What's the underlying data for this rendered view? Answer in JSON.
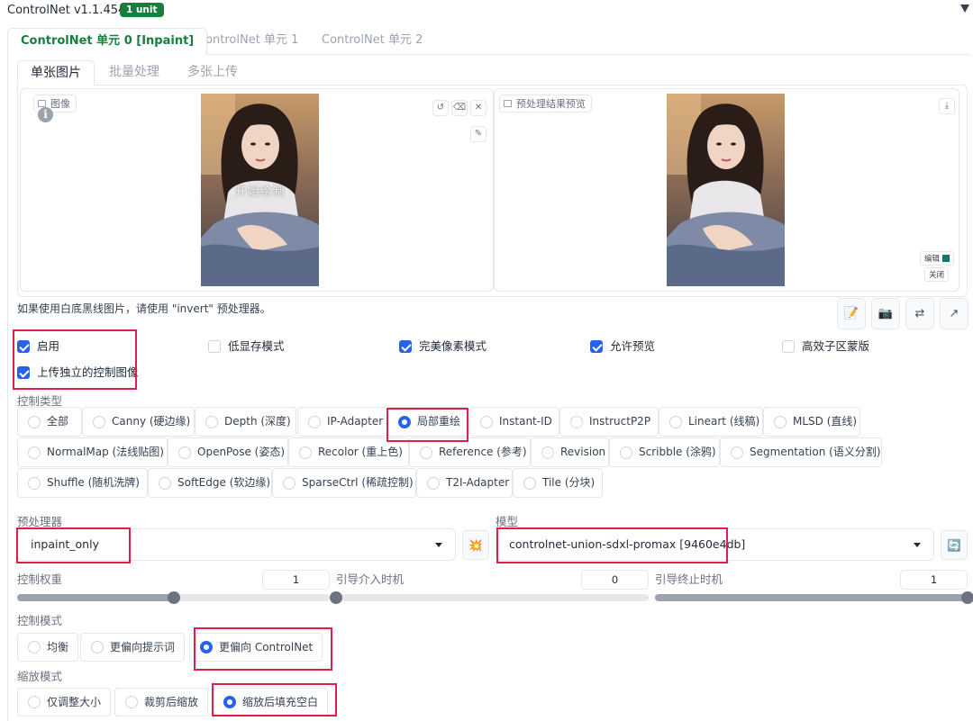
{
  "header": {
    "title": "ControlNet v1.1.454",
    "badge": "1 unit"
  },
  "outer_tabs": [
    {
      "label": "ControlNet 单元 0 [Inpaint]",
      "active": true
    },
    {
      "label": "ControlNet 单元 1",
      "active": false
    },
    {
      "label": "ControlNet 单元 2",
      "active": false
    }
  ],
  "inner_tabs": [
    {
      "label": "单张图片",
      "active": true
    },
    {
      "label": "批量处理",
      "active": false
    },
    {
      "label": "多张上传",
      "active": false
    }
  ],
  "image_input": {
    "label": "图像",
    "overlay_text": "开始绘制",
    "buttons": {
      "undo": "↺",
      "clear": "⌫",
      "close": "✕",
      "brush": "✎"
    }
  },
  "preview": {
    "label": "预处理结果预览",
    "download": "⤓",
    "edit_label": "编辑",
    "close_label": "关闭"
  },
  "tip": "如果使用白底黑线图片，请使用 \"invert\" 预处理器。",
  "tool_buttons": [
    "📝",
    "📷",
    "⇄",
    "↗"
  ],
  "checkboxes": [
    {
      "label": "启用",
      "checked": true
    },
    {
      "label": "低显存模式",
      "checked": false
    },
    {
      "label": "完美像素模式",
      "checked": true
    },
    {
      "label": "允许预览",
      "checked": true
    },
    {
      "label": "高效子区蒙版",
      "checked": false
    },
    {
      "label": "上传独立的控制图像",
      "checked": true
    }
  ],
  "control_type": {
    "label": "控制类型",
    "options": [
      "全部",
      "Canny (硬边缘)",
      "Depth (深度)",
      "IP-Adapter",
      "局部重绘",
      "Instant-ID",
      "InstructP2P",
      "Lineart (线稿)",
      "MLSD (直线)",
      "NormalMap (法线贴图)",
      "OpenPose (姿态)",
      "Recolor (重上色)",
      "Reference (参考)",
      "Revision",
      "Scribble (涂鸦)",
      "Segmentation (语义分割)",
      "Shuffle (随机洗牌)",
      "SoftEdge (软边缘)",
      "SparseCtrl (稀疏控制)",
      "T2I-Adapter",
      "Tile (分块)"
    ],
    "selected": "局部重绘"
  },
  "preprocessor": {
    "label": "预处理器",
    "value": "inpaint_only",
    "run_icon": "💥"
  },
  "model": {
    "label": "模型",
    "value": "controlnet-union-sdxl-promax [9460e4db]",
    "refresh_icon": "🔄"
  },
  "sliders": {
    "weight": {
      "label": "控制权重",
      "value": "1",
      "fraction": 0.5
    },
    "start": {
      "label": "引导介入时机",
      "value": "0",
      "fraction": 0.0
    },
    "end": {
      "label": "引导终止时机",
      "value": "1",
      "fraction": 1.0
    }
  },
  "control_mode": {
    "label": "控制模式",
    "options": [
      "均衡",
      "更偏向提示词",
      "更偏向 ControlNet"
    ],
    "selected": "更偏向 ControlNet"
  },
  "resize_mode": {
    "label": "缩放模式",
    "options": [
      "仅调整大小",
      "裁剪后缩放",
      "缩放后填充空白"
    ],
    "selected": "缩放后填充空白"
  },
  "colors": {
    "accent": "#2563eb",
    "green": "#15803d",
    "highlight": "#e11d48"
  }
}
